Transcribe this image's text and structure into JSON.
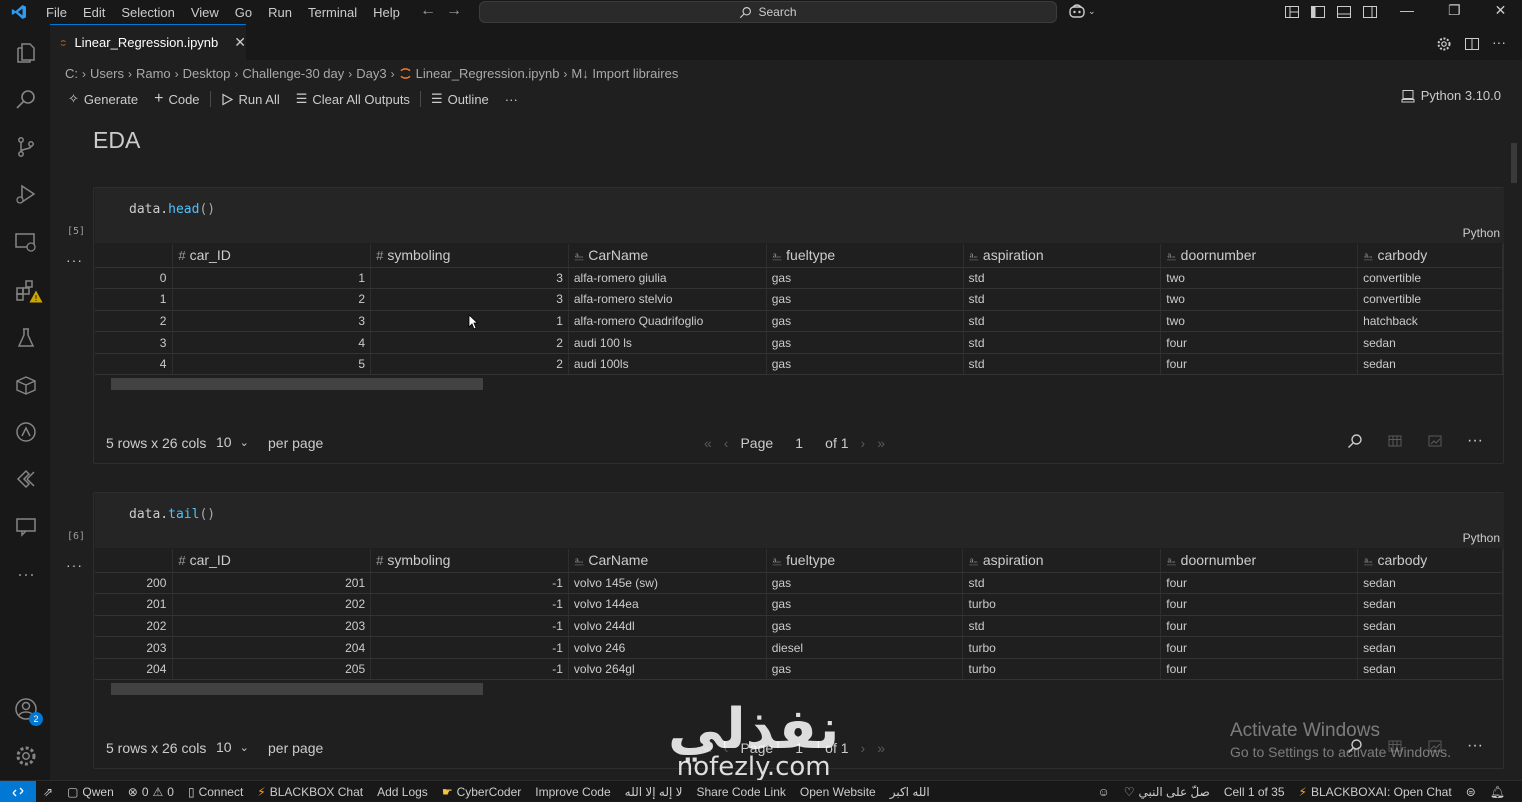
{
  "menu": [
    "File",
    "Edit",
    "Selection",
    "View",
    "Go",
    "Run",
    "Terminal",
    "Help"
  ],
  "search": {
    "label": "Search"
  },
  "tab": {
    "label": "Linear_Regression.ipynb"
  },
  "breadcrumb": [
    "C:",
    "Users",
    "Ramo",
    "Desktop",
    "Challenge-30 day",
    "Day3",
    "Linear_Regression.ipynb",
    "M↓ Import libraires"
  ],
  "toolbar": {
    "generate": "Generate",
    "code": "Code",
    "run_all": "Run All",
    "clear_outputs": "Clear All Outputs",
    "outline": "Outline",
    "kernel": "Python 3.10.0"
  },
  "heading": "EDA",
  "columns": [
    "car_ID",
    "symboling",
    "CarName",
    "fueltype",
    "aspiration",
    "doornumber",
    "carbody"
  ],
  "column_types": [
    "#",
    "#",
    "A",
    "A",
    "A",
    "A",
    "A"
  ],
  "cells": [
    {
      "exec": "[5]",
      "code_obj": "data.",
      "code_fn": "head",
      "code_paren": "()",
      "lang": "Python",
      "rows": [
        [
          "0",
          "1",
          "3",
          "alfa-romero giulia",
          "gas",
          "std",
          "two",
          "convertible"
        ],
        [
          "1",
          "2",
          "3",
          "alfa-romero stelvio",
          "gas",
          "std",
          "two",
          "convertible"
        ],
        [
          "2",
          "3",
          "1",
          "alfa-romero Quadrifoglio",
          "gas",
          "std",
          "two",
          "hatchback"
        ],
        [
          "3",
          "4",
          "2",
          "audi 100 ls",
          "gas",
          "std",
          "four",
          "sedan"
        ],
        [
          "4",
          "5",
          "2",
          "audi 100ls",
          "gas",
          "std",
          "four",
          "sedan"
        ]
      ],
      "footer": {
        "rows_cols": "5 rows x 26 cols",
        "per_page_value": "10",
        "per_page_label": "per page",
        "page_label": "Page",
        "page_value": "1",
        "of_label": "of 1"
      }
    },
    {
      "exec": "[6]",
      "code_obj": "data.",
      "code_fn": "tail",
      "code_paren": "()",
      "lang": "Python",
      "rows": [
        [
          "200",
          "201",
          "-1",
          "volvo 145e (sw)",
          "gas",
          "std",
          "four",
          "sedan"
        ],
        [
          "201",
          "202",
          "-1",
          "volvo 144ea",
          "gas",
          "turbo",
          "four",
          "sedan"
        ],
        [
          "202",
          "203",
          "-1",
          "volvo 244dl",
          "gas",
          "std",
          "four",
          "sedan"
        ],
        [
          "203",
          "204",
          "-1",
          "volvo 246",
          "diesel",
          "turbo",
          "four",
          "sedan"
        ],
        [
          "204",
          "205",
          "-1",
          "volvo 264gl",
          "gas",
          "turbo",
          "four",
          "sedan"
        ]
      ],
      "footer": {
        "rows_cols": "5 rows x 26 cols",
        "per_page_value": "10",
        "per_page_label": "per page",
        "page_label": "Page",
        "page_value": "1",
        "of_label": "of 1"
      }
    }
  ],
  "watermark": {
    "arabic": "نفذلي",
    "latin": "nofezly.com"
  },
  "activate": {
    "title": "Activate Windows",
    "subtitle": "Go to Settings to activate Windows."
  },
  "statusbar": {
    "qwen": "Qwen",
    "errors": "0",
    "warnings": "0",
    "connect": "Connect",
    "blackbox_chat": "BLACKBOX Chat",
    "add_logs": "Add Logs",
    "cybercoder": "CyberCoder",
    "improve_code": "Improve Code",
    "dhikr1": "لا إله إلا الله",
    "share_code": "Share Code Link",
    "open_website": "Open Website",
    "dhikr2": "الله اكبر",
    "dhikr3": "صلّ على النبي",
    "cell_pos": "Cell 1 of 35",
    "blackboxai": "BLACKBOXAI: Open Chat"
  },
  "accounts_badge": "2",
  "colors": {
    "accent": "#0078d4",
    "function": "#4fc1ff",
    "background": "#1f1f1f",
    "chrome": "#181818"
  }
}
